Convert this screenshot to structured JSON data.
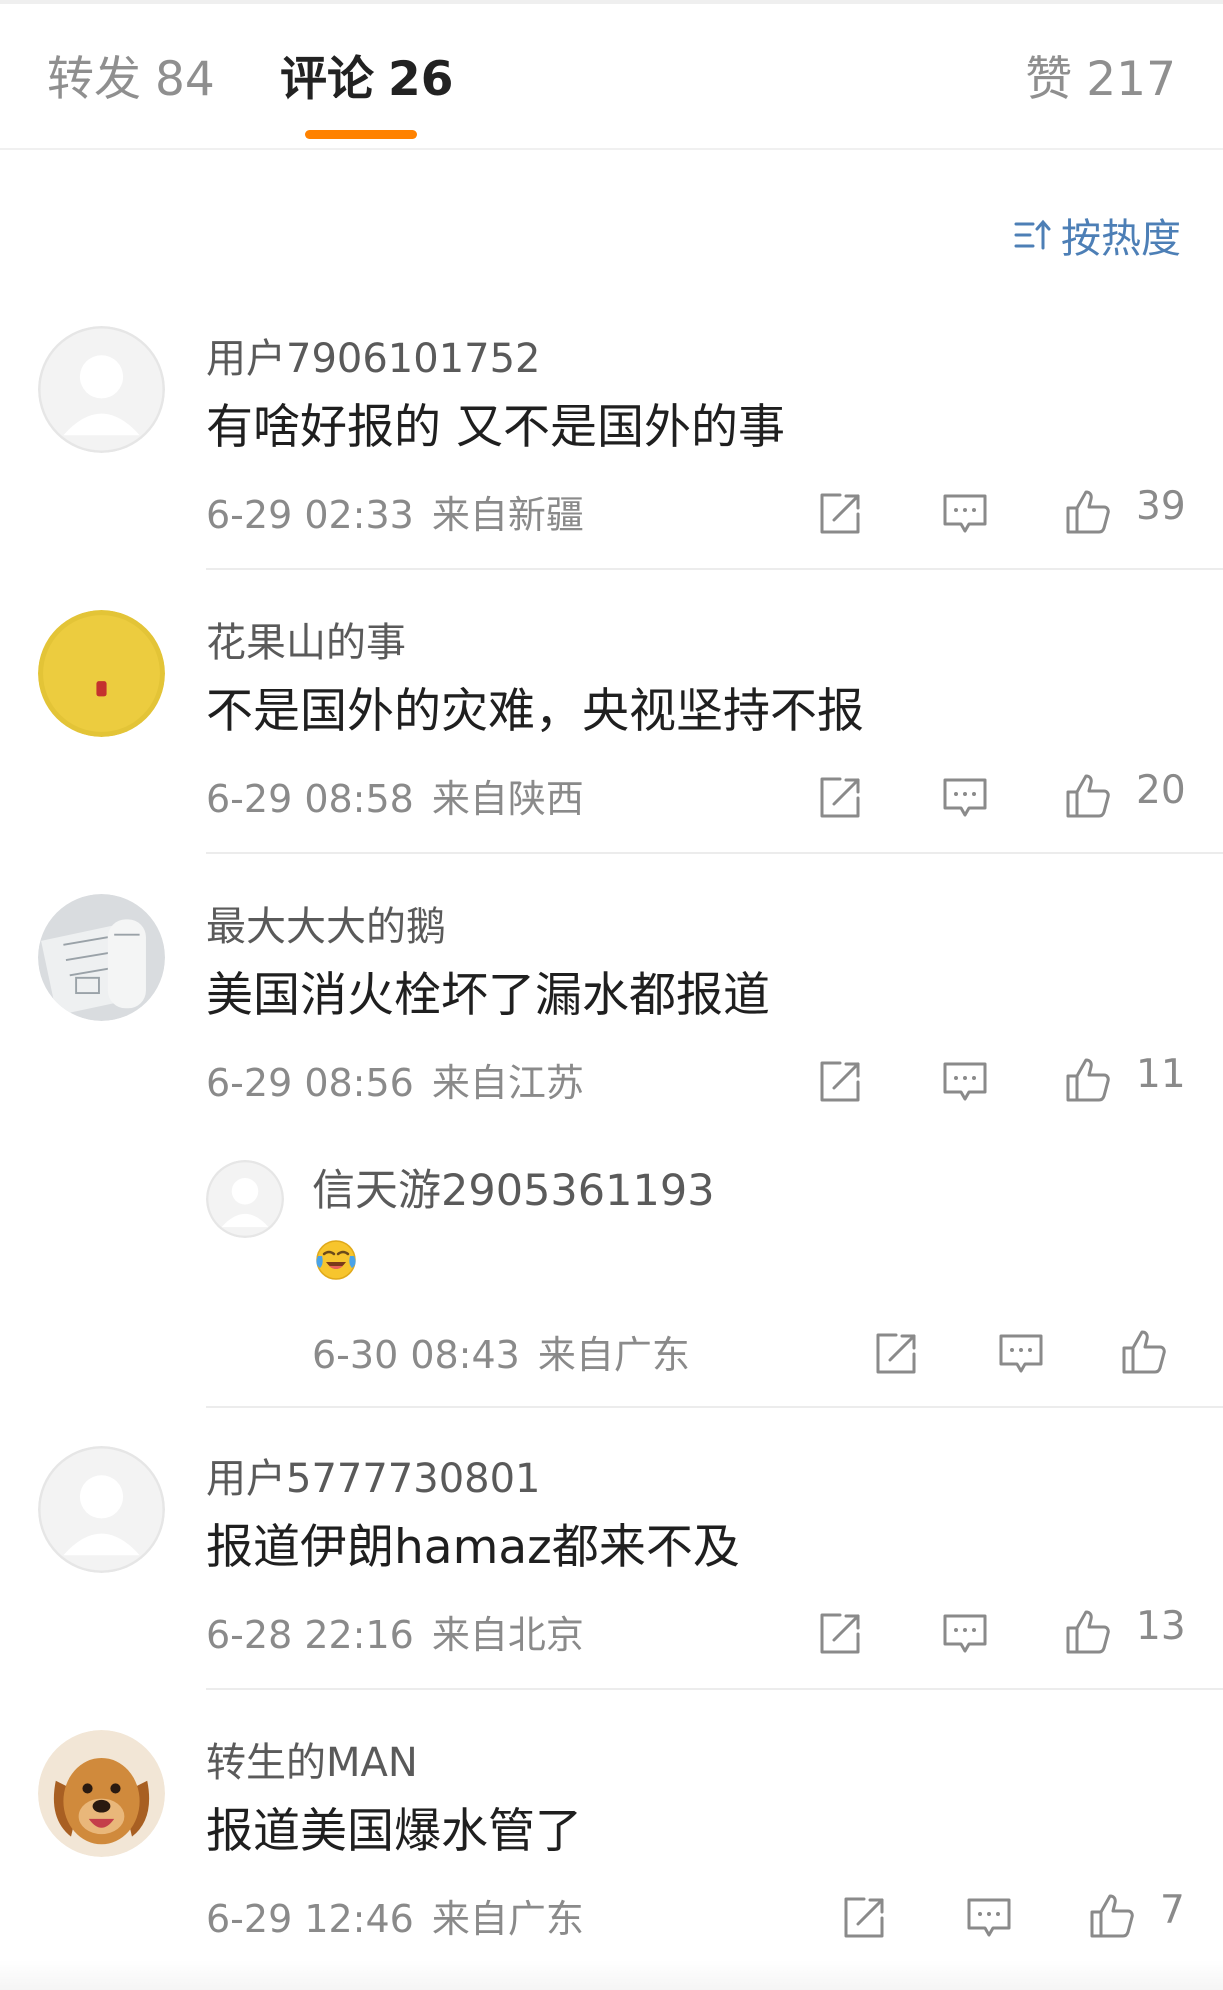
{
  "tabs": {
    "repost": {
      "label": "转发",
      "count": "84"
    },
    "comments": {
      "label": "评论",
      "count": "26"
    },
    "likes": {
      "label": "赞",
      "count": "217"
    }
  },
  "sort": {
    "label": "按热度",
    "icon": "sort-icon"
  },
  "colors": {
    "accent": "#ff8200",
    "link": "#4d7fb6",
    "meta": "#8a8a8a"
  },
  "comments": [
    {
      "user": "用户7906101752",
      "text": "有啥好报的 又不是国外的事",
      "time": "6-29 02:33",
      "location": "来自新疆",
      "likes": "39",
      "avatar": "default-avatar"
    },
    {
      "user": "花果山的事",
      "text": "不是国外的灾难，央视坚持不报",
      "time": "6-29 08:58",
      "location": "来自陕西",
      "likes": "20",
      "avatar": "yellow-seal-avatar"
    },
    {
      "user": "最大大大的鹅",
      "text": "美国消火栓坏了漏水都报道",
      "time": "6-29 08:56",
      "location": "来自江苏",
      "likes": "11",
      "avatar": "blueprint-avatar"
    },
    {
      "user": "用户5777730801",
      "text": "报道伊朗hamaz都来不及",
      "time": "6-28 22:16",
      "location": "来自北京",
      "likes": "13",
      "avatar": "default-avatar"
    },
    {
      "user": "转生的MAN",
      "text": "报道美国爆水管了",
      "time": "6-29 12:46",
      "location": "来自广东",
      "likes": "7",
      "avatar": "dog-avatar"
    }
  ],
  "reply": {
    "user": "信天游2905361193",
    "emoji": "laugh-cry-emoji",
    "time": "6-30 08:43",
    "location": "来自广东"
  }
}
